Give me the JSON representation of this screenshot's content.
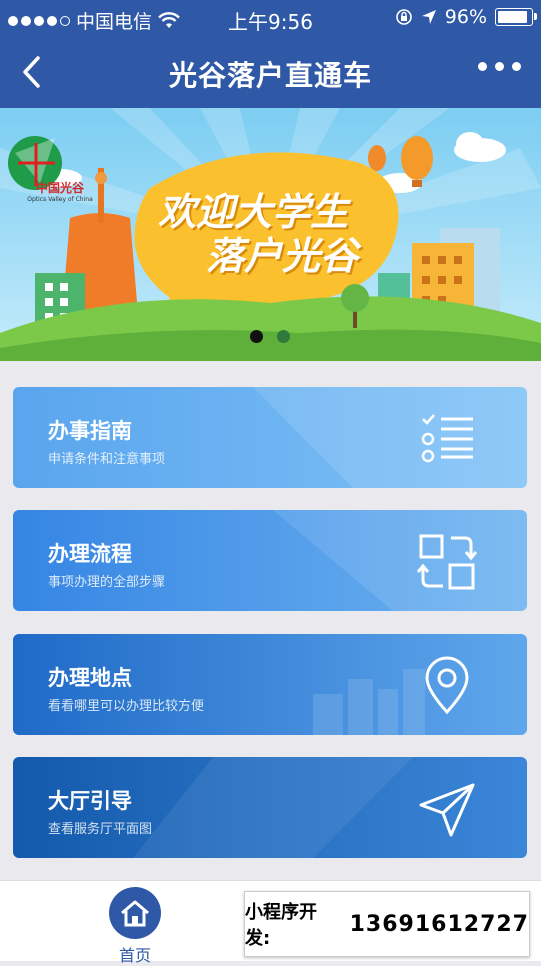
{
  "status_bar": {
    "carrier": "中国电信",
    "time": "上午9:56",
    "battery": "96%",
    "battery_level": 0.96
  },
  "nav": {
    "title": "光谷落户直通车",
    "back_icon": "chevron-left-icon",
    "more_icon": "more-dots-icon"
  },
  "banner": {
    "logo_text": "中国光谷",
    "logo_subtext": "Optics Valley of China",
    "headline_line1": "欢迎大学生",
    "headline_line2": "落户光谷",
    "slide_count": 2,
    "active_slide": 1
  },
  "menu": [
    {
      "title": "办事指南",
      "subtitle": "申请条件和注意事项",
      "icon": "checklist-icon",
      "color": "#5fa9ef"
    },
    {
      "title": "办理流程",
      "subtitle": "事项办理的全部步骤",
      "icon": "process-icon",
      "color": "#3a87e6"
    },
    {
      "title": "办理地点",
      "subtitle": "看看哪里可以办理比较方便",
      "icon": "location-pin-icon",
      "color": "#2a72cf"
    },
    {
      "title": "大厅引导",
      "subtitle": "查看服务厅平面图",
      "icon": "navigation-arrow-icon",
      "color": "#1d5fb8"
    }
  ],
  "tab_bar": {
    "home_label": "首页"
  },
  "promo": {
    "label": "小程序开发:",
    "phone": "13691612727"
  },
  "colors": {
    "primary": "#2f59a6",
    "banner_sky": "#8fd3f4",
    "banner_grass": "#7cc94a"
  }
}
